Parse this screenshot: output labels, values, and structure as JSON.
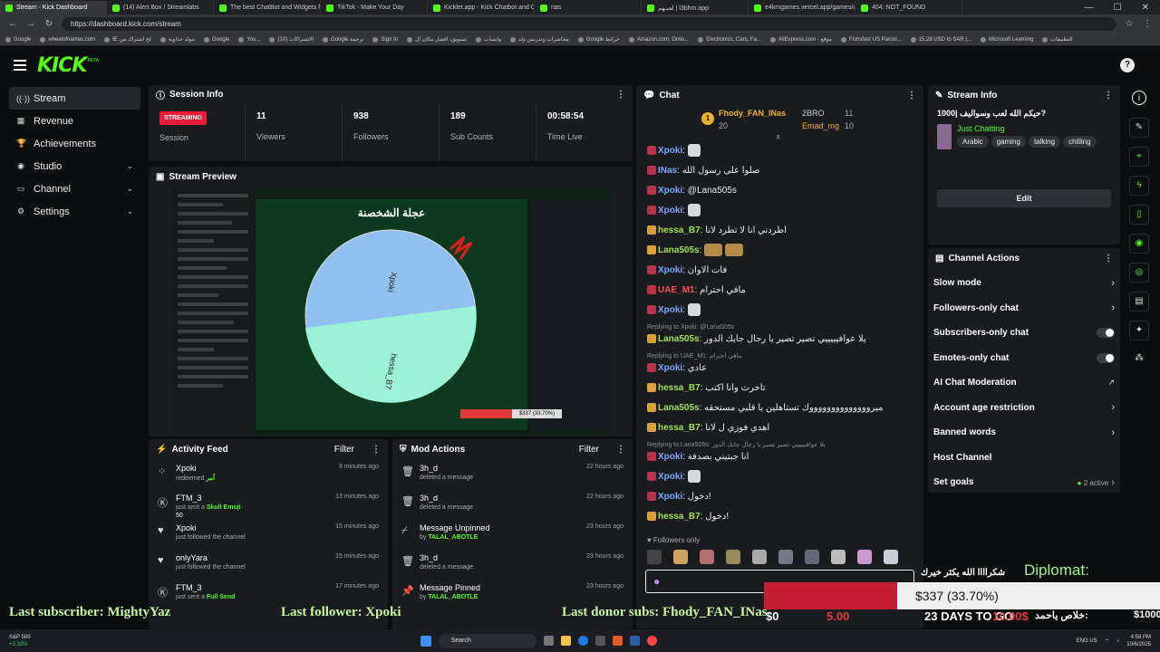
{
  "browser": {
    "tabs": [
      "Stream - Kick Dashboard",
      "(14) Alert Box / Streamlabs",
      "The best ChatBot and Widgets fo",
      "TikTok - Make Your Day",
      "Kicklet.app - Kick Chatbot and C",
      "nas",
      "لعبـهم | l3bhm.app",
      "e4kmgames.vercel.app/games/u",
      "404: NOT_FOUND"
    ],
    "url": "https://dashboard.kick.com/stream",
    "bookmarks": [
      "Google",
      "wheelofnames.com",
      "IE لخ اشتراك من",
      "مولد خداوية",
      "Google",
      "You...",
      "الاشتراكات (10)",
      "Google ترجمة",
      "Sign In",
      "تسويق، افضل مكان ال",
      "واتساب",
      "محاضرات وتدريس ولد",
      "Google خرائط",
      "Amazon.com: Onlin...",
      "Electronics, Cars, Fa...",
      "AliExpress.com - موقع",
      "Fishsfast US Parcel...",
      "15.28 USD to SAR |...",
      "Microsoft Learning",
      "التطبيقات"
    ]
  },
  "app": {
    "logo": "KICK",
    "beta": "BETA",
    "user_initial": "?"
  },
  "sidebar": {
    "items": [
      {
        "label": "Stream",
        "icon": "stream-icon"
      },
      {
        "label": "Revenue",
        "icon": "revenue-icon"
      },
      {
        "label": "Achievements",
        "icon": "trophy-icon"
      },
      {
        "label": "Studio",
        "icon": "studio-icon"
      },
      {
        "label": "Channel",
        "icon": "channel-icon"
      },
      {
        "label": "Settings",
        "icon": "gear-icon"
      }
    ]
  },
  "session": {
    "title": "Session Info",
    "status": "STREAMING",
    "status_label": "Session",
    "viewers": "11",
    "viewers_label": "Viewers",
    "followers": "938",
    "followers_label": "Followers",
    "subs": "189",
    "subs_label": "Sub Counts",
    "time": "00:58:54",
    "time_label": "Time Live"
  },
  "preview": {
    "title": "Stream Preview",
    "game_title": "عجلة الشخصنة",
    "wheel_a": "Xpoki",
    "wheel_b": "hessa_B7",
    "bar_text": "$337 (33.70%)"
  },
  "activity": {
    "title": "Activity Feed",
    "filter": "Filter",
    "items": [
      {
        "name": "Xpoki",
        "desc": "redeemed",
        "extra": "أمر",
        "time": "9 minutes ago",
        "icon": "redeem-icon"
      },
      {
        "name": "FTM_3",
        "desc": "just sent a",
        "extra": "Skull Emoji",
        "sub": "50",
        "time": "13 minutes ago",
        "icon": "kicks-icon"
      },
      {
        "name": "Xpoki",
        "desc": "just followed the channel",
        "extra": "",
        "time": "15 minutes ago",
        "icon": "heart-icon"
      },
      {
        "name": "onlyYara",
        "desc": "just followed the channel",
        "extra": "",
        "time": "15 minutes ago",
        "icon": "heart-icon"
      },
      {
        "name": "FTM_3",
        "desc": "just sent a",
        "extra": "Full Send",
        "time": "17 minutes ago",
        "icon": "kicks-icon"
      }
    ]
  },
  "mod": {
    "title": "Mod Actions",
    "filter": "Filter",
    "items": [
      {
        "name": "3h_d",
        "desc": "deleted a message",
        "time": "22 hours ago",
        "icon": "trash-icon"
      },
      {
        "name": "3h_d",
        "desc": "deleted a message",
        "time": "22 hours ago",
        "icon": "trash-icon"
      },
      {
        "name": "Message Unpinned",
        "desc": "by",
        "by": "TALAL_ABOTLE",
        "time": "23 hours ago",
        "icon": "unpin-icon"
      },
      {
        "name": "3h_d",
        "desc": "deleted a message",
        "time": "23 hours ago",
        "icon": "trash-icon"
      },
      {
        "name": "Message Pinned",
        "desc": "by",
        "by": "TALAL_ABOTLE",
        "time": "23 hours ago",
        "icon": "pin-icon"
      }
    ]
  },
  "chat": {
    "title": "Chat",
    "leaders": {
      "first": "Fhody_FAN_INas",
      "first_val": "20",
      "second": "2BRO",
      "second_val": "11",
      "third": "Emad_mg",
      "third_val": "10"
    },
    "messages": [
      {
        "user": "Xpoki",
        "text": "",
        "emote": true,
        "color": "b"
      },
      {
        "user": "INas",
        "text": "صلوا على رسول الله",
        "color": "b"
      },
      {
        "user": "Xpoki",
        "text": "@Lana505s",
        "color": "b"
      },
      {
        "user": "Xpoki",
        "text": "",
        "emote": true,
        "color": "b"
      },
      {
        "user": "hessa_B7",
        "text": "اطردني انا لا تطرد لانا",
        "color": "g"
      },
      {
        "user": "Lana505s",
        "text": "",
        "emote2": true,
        "color": "g"
      },
      {
        "user": "Xpoki",
        "text": "فات الاوان",
        "color": "b"
      },
      {
        "user": "UAE_M1",
        "text": "مافي احترام",
        "color": "r"
      },
      {
        "user": "Xpoki",
        "text": "",
        "emote": true,
        "color": "b"
      },
      {
        "reply": "Replying to Xpoki: @Lana505s",
        "user": "Lana505s",
        "text": "يلا عوافيييييي تصير تصير يا رجال جايك الدور",
        "color": "g"
      },
      {
        "reply": "Replying to UAE_M1: مافي احترام",
        "user": "Xpoki",
        "text": "عادي",
        "color": "b"
      },
      {
        "user": "hessa_B7",
        "text": "تاخرت وانا اكتب",
        "color": "g"
      },
      {
        "user": "Lana505s",
        "text": "ميرووووووووووووووك تستاهلين يا قلبي مستحقه",
        "color": "g"
      },
      {
        "user": "hessa_B7",
        "text": "اهدي فوزي ل لانا",
        "color": "g"
      },
      {
        "reply": "Replying to Lana505s: يلا عوافيييييي تصير تصير يا رجال جايك الدور",
        "user": "Xpoki",
        "text": "انا جبتيني بصدفة",
        "color": "b"
      },
      {
        "user": "Xpoki",
        "text": "",
        "emote": true,
        "color": "b"
      },
      {
        "user": "Xpoki",
        "text": "دخول!",
        "color": "b"
      },
      {
        "user": "hessa_B7",
        "text": "دخول!",
        "color": "g"
      }
    ],
    "followers_only": "Followers only",
    "input_placeholder": ""
  },
  "stream_info": {
    "title": "Stream Info",
    "stream_title": "حيكم الله لعب وسواليف |1000?",
    "category": "Just Chatting",
    "tags": [
      "Arabic",
      "gaming",
      "talking",
      "chilling"
    ],
    "edit": "Edit"
  },
  "channel_actions": {
    "title": "Channel Actions",
    "items": [
      {
        "label": "Slow mode",
        "type": "chevron"
      },
      {
        "label": "Followers-only chat",
        "type": "chevron"
      },
      {
        "label": "Subscribers-only chat",
        "type": "toggle"
      },
      {
        "label": "Emotes-only chat",
        "type": "toggle"
      },
      {
        "label": "AI Chat Moderation",
        "type": "external"
      },
      {
        "label": "Account age restriction",
        "type": "chevron"
      },
      {
        "label": "Banned words",
        "type": "chevron"
      },
      {
        "label": "Host Channel",
        "type": "none"
      },
      {
        "label": "Set goals",
        "type": "active",
        "extra": "2 active"
      }
    ]
  },
  "overlay": {
    "last_sub": "Last subscriber: MightyYaz",
    "last_follower": "Last follower: Xpoki",
    "last_donor": "Last donor subs: Fhody_FAN_INas",
    "goal": "Diplomat: $1,000.00",
    "goal_progress": "$337 (33.70%)",
    "goal_start": "$0",
    "goal_end": "$1000",
    "thanks": "شكراااا الله يكثر خيرك",
    "ticker": "23 DAYS TO GO",
    "ticker2": "خلاص ياحمد:",
    "amount_a": "5.00",
    "amount_b": "10.00$"
  },
  "taskbar": {
    "search": "Search",
    "weather": "S&P 500",
    "weather_sub": "+0.32%",
    "lang": "ENG US",
    "time": "4:58 PM",
    "date": "10/6/2025"
  }
}
